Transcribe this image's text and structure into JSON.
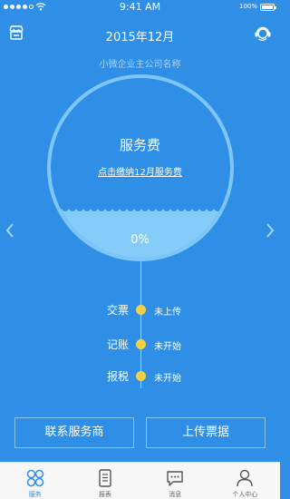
{
  "status_bar": {
    "time": "9:41 AM",
    "battery": "100%"
  },
  "header": {
    "title": "2015年12月",
    "left_icon": "store-icon",
    "right_icon": "customer-service-icon"
  },
  "company_name": "小微企业主公司名称",
  "service_circle": {
    "title": "服务费",
    "link": "点击缴纳12月服务费",
    "progress_text": "0%",
    "progress": 0
  },
  "timeline": [
    {
      "label": "交票",
      "status": "未上传"
    },
    {
      "label": "记账",
      "status": "未开始"
    },
    {
      "label": "报税",
      "status": "未开始"
    }
  ],
  "buttons": {
    "contact": "联系服务商",
    "upload": "上传票据"
  },
  "tabs": [
    {
      "label": "服务",
      "icon": "services-grid-icon",
      "active": true
    },
    {
      "label": "报表",
      "icon": "report-icon",
      "active": false
    },
    {
      "label": "消息",
      "icon": "message-icon",
      "active": false
    },
    {
      "label": "个人中心",
      "icon": "person-icon",
      "active": false
    }
  ],
  "colors": {
    "primary": "#2f8fe6",
    "water": "#86ccf8",
    "dot": "#f6cf45"
  }
}
